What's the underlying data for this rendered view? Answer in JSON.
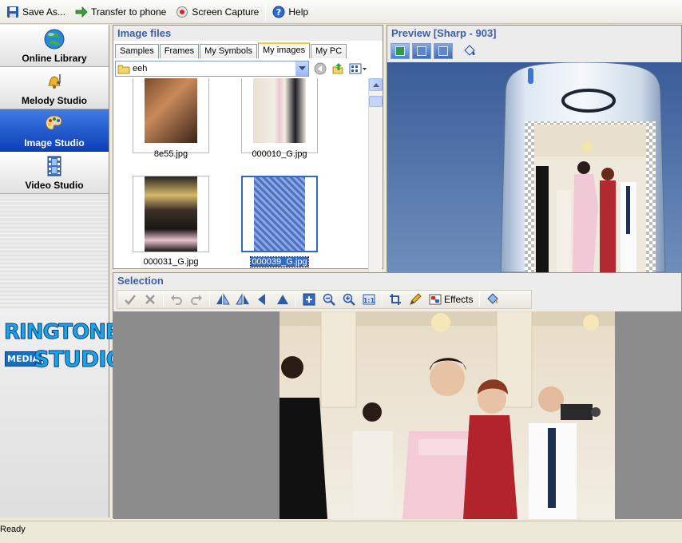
{
  "toolbar": {
    "save_as": "Save As...",
    "transfer": "Transfer to phone",
    "screen_capture": "Screen Capture",
    "help": "Help"
  },
  "sidebar": {
    "items": [
      {
        "label": "Online Library",
        "icon": "globe-icon"
      },
      {
        "label": "Melody Studio",
        "icon": "bell-icon"
      },
      {
        "label": "Image Studio",
        "icon": "palette-icon",
        "active": true
      },
      {
        "label": "Video Studio",
        "icon": "film-icon"
      }
    ],
    "logo": {
      "line1": "RINGTONE",
      "line2": "MEDIA",
      "line3": "STUDIO"
    }
  },
  "image_files": {
    "title": "Image files",
    "tabs": [
      "Samples",
      "Frames",
      "My Symbols",
      "My images",
      "My PC"
    ],
    "active_tab": "My images",
    "folder": "eeh",
    "files": [
      {
        "name": "8e55.jpg"
      },
      {
        "name": "000010_G.jpg"
      },
      {
        "name": "000031_G.jpg"
      },
      {
        "name": "000039_G.jpg",
        "selected": true
      }
    ]
  },
  "preview": {
    "title": "Preview [Sharp - 903]"
  },
  "selection": {
    "title": "Selection",
    "effects_label": "Effects"
  },
  "status": {
    "text": "Ready"
  },
  "colors": {
    "panel_title": "#3b5fa8",
    "active_sidebar": "#1a4fcc",
    "selection_bg": "#316ac5"
  }
}
